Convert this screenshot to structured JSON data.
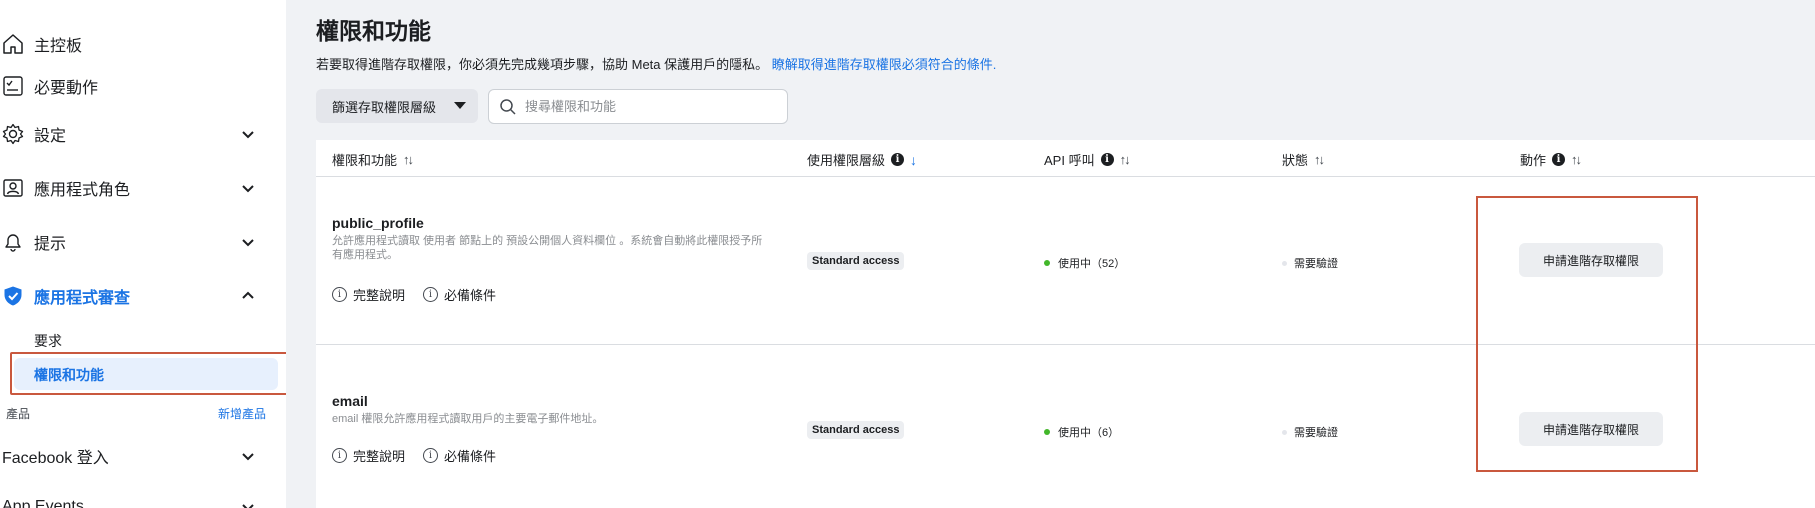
{
  "sidebar": {
    "items": [
      {
        "label": "主控板",
        "icon": "home-icon"
      },
      {
        "label": "必要動作",
        "icon": "checklist-icon"
      },
      {
        "label": "設定",
        "icon": "gear-icon"
      },
      {
        "label": "應用程式角色",
        "icon": "user-badge-icon"
      },
      {
        "label": "提示",
        "icon": "bell-icon"
      },
      {
        "label": "應用程式審查",
        "icon": "shield-check-icon"
      },
      {
        "label": "Facebook 登入"
      },
      {
        "label": "App Events"
      }
    ],
    "review_sub": {
      "requests": "要求",
      "permissions": "權限和功能"
    },
    "products_label": "產品",
    "add_product": "新增產品"
  },
  "main": {
    "title": "權限和功能",
    "desc_text": "若要取得進階存取權限，你必須先完成幾項步驟，協助 Meta 保護用戶的隱私。",
    "desc_link": "瞭解取得進階存取權限必須符合的條件.",
    "filter_label": "篩選存取權限層級",
    "search_placeholder": "搜尋權限和功能"
  },
  "table": {
    "headers": {
      "permission": "權限和功能",
      "access_level": "使用權限層級",
      "api_calls": "API 呼叫",
      "status": "狀態",
      "action": "動作"
    },
    "sort_symbol": "↑↓",
    "sort_active_symbol": "↓",
    "rows": [
      {
        "name": "public_profile",
        "desc": "允許應用程式讀取 使用者 節點上的 預設公開個人資料欄位 。系統會自動將此權限授予所有應用程式。",
        "full_desc": "完整說明",
        "requirements": "必備條件",
        "access": "Standard access",
        "api": "使用中（52）",
        "status": "需要驗證",
        "action": "申請進階存取權限"
      },
      {
        "name": "email",
        "desc": "email 權限允許應用程式讀取用戶的主要電子郵件地址。",
        "full_desc": "完整說明",
        "requirements": "必備條件",
        "access": "Standard access",
        "api": "使用中（6）",
        "status": "需要驗證",
        "action": "申請進階存取權限"
      }
    ]
  },
  "colors": {
    "accent": "#1b74e4",
    "highlight": "#c9583e",
    "active_dot": "#42b72a"
  }
}
